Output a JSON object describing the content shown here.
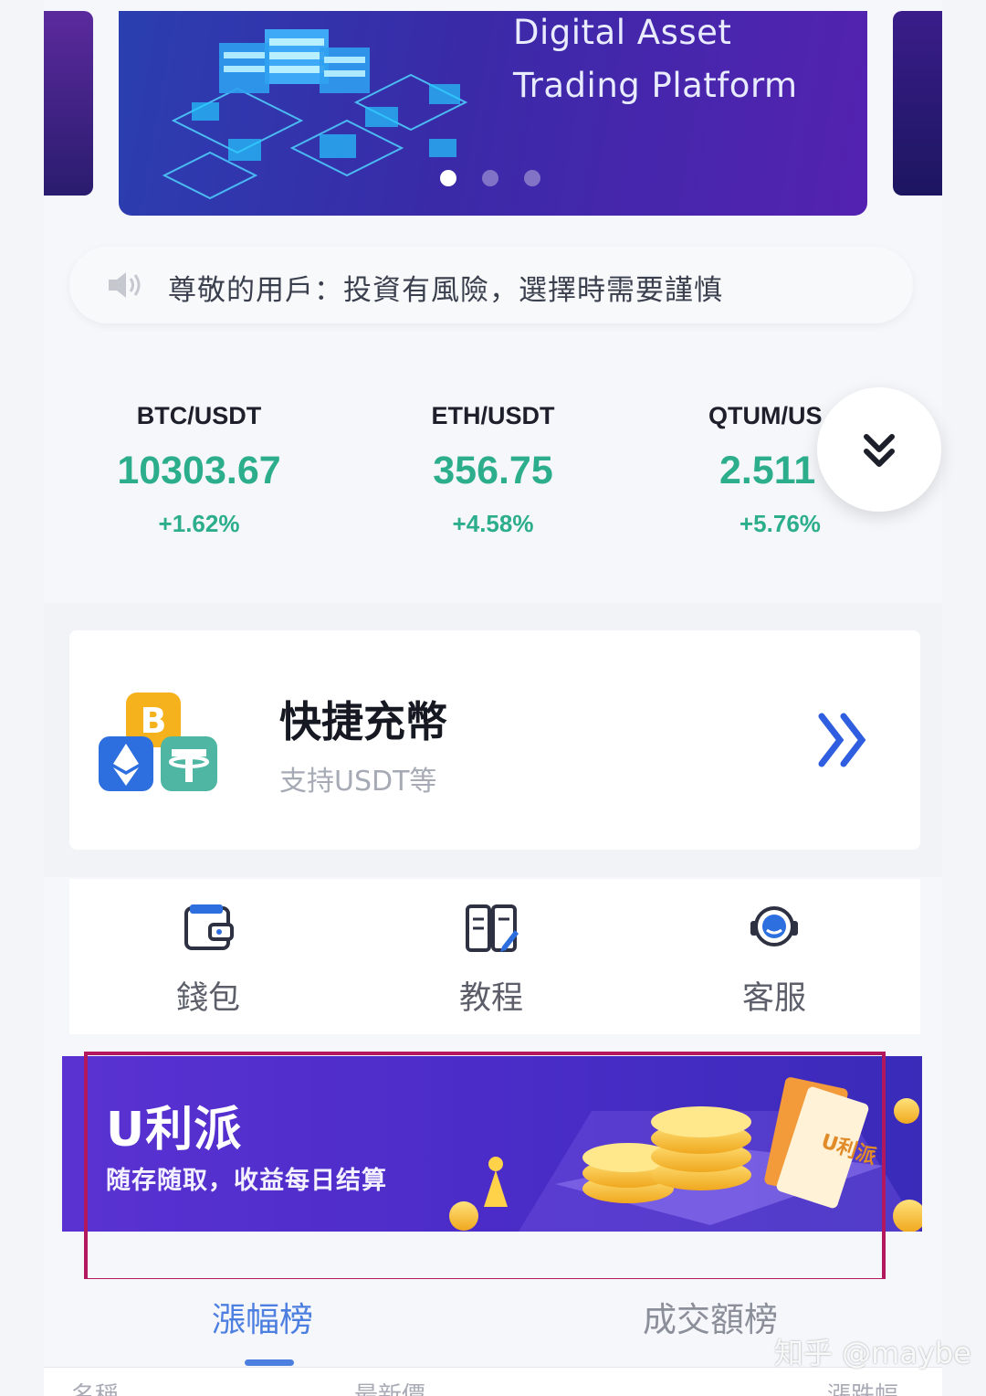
{
  "banner": {
    "title_line1": "Digital Asset",
    "title_line2": "Trading Platform",
    "pagination": {
      "count": 3,
      "active_index": 0
    }
  },
  "notice": {
    "icon": "speaker-icon",
    "text": "尊敬的用戶：投資有風險，選擇時需要謹慎"
  },
  "tickers": [
    {
      "pair": "BTC/USDT",
      "price": "10303.67",
      "change": "+1.62%"
    },
    {
      "pair": "ETH/USDT",
      "price": "356.75",
      "change": "+4.58%"
    },
    {
      "pair": "QTUM/US",
      "price": "2.511",
      "change": "+5.76%"
    }
  ],
  "expand_button": {
    "icon": "double-chevron-down-icon"
  },
  "quick_deposit": {
    "title": "快捷充幣",
    "subtitle": "支持USDT等",
    "icon": "crypto-coins-icon",
    "arrow_icon": "double-chevron-right-icon"
  },
  "shortcuts": [
    {
      "label": "錢包",
      "icon": "wallet-icon"
    },
    {
      "label": "教程",
      "icon": "tutorial-icon"
    },
    {
      "label": "客服",
      "icon": "headset-icon"
    }
  ],
  "promo": {
    "title": "U利派",
    "subtitle": "随存随取，收益每日结算",
    "ticket_text": "U利派"
  },
  "tabs": [
    {
      "label": "漲幅榜",
      "active": true
    },
    {
      "label": "成交額榜",
      "active": false
    }
  ],
  "table_headers": [
    "名稱",
    "最新價",
    "漲跌幅"
  ],
  "watermark": "知乎 @maybe",
  "colors": {
    "positive": "#2cae8c",
    "accent": "#4c7fe0",
    "promo_bg": "#4b2cc8",
    "highlight": "#b3175e"
  }
}
